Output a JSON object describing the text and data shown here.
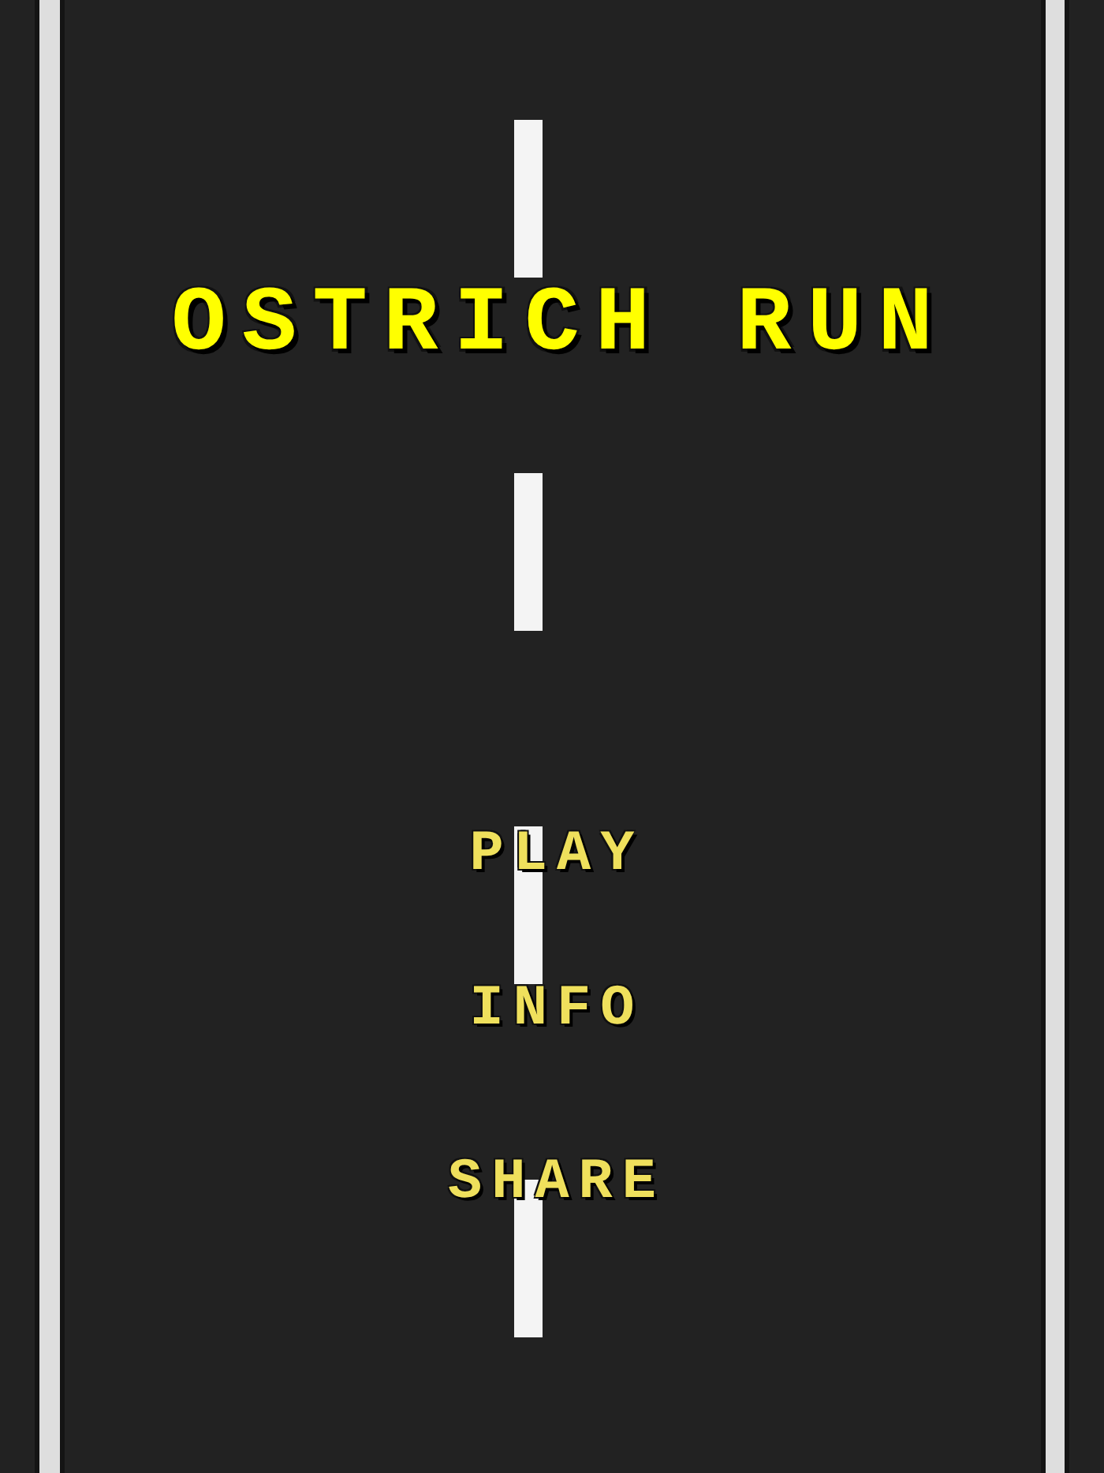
{
  "title": "OSTRICH RUN",
  "menu": [
    {
      "label": "PLAY"
    },
    {
      "label": "INFO"
    },
    {
      "label": "SHARE"
    }
  ]
}
